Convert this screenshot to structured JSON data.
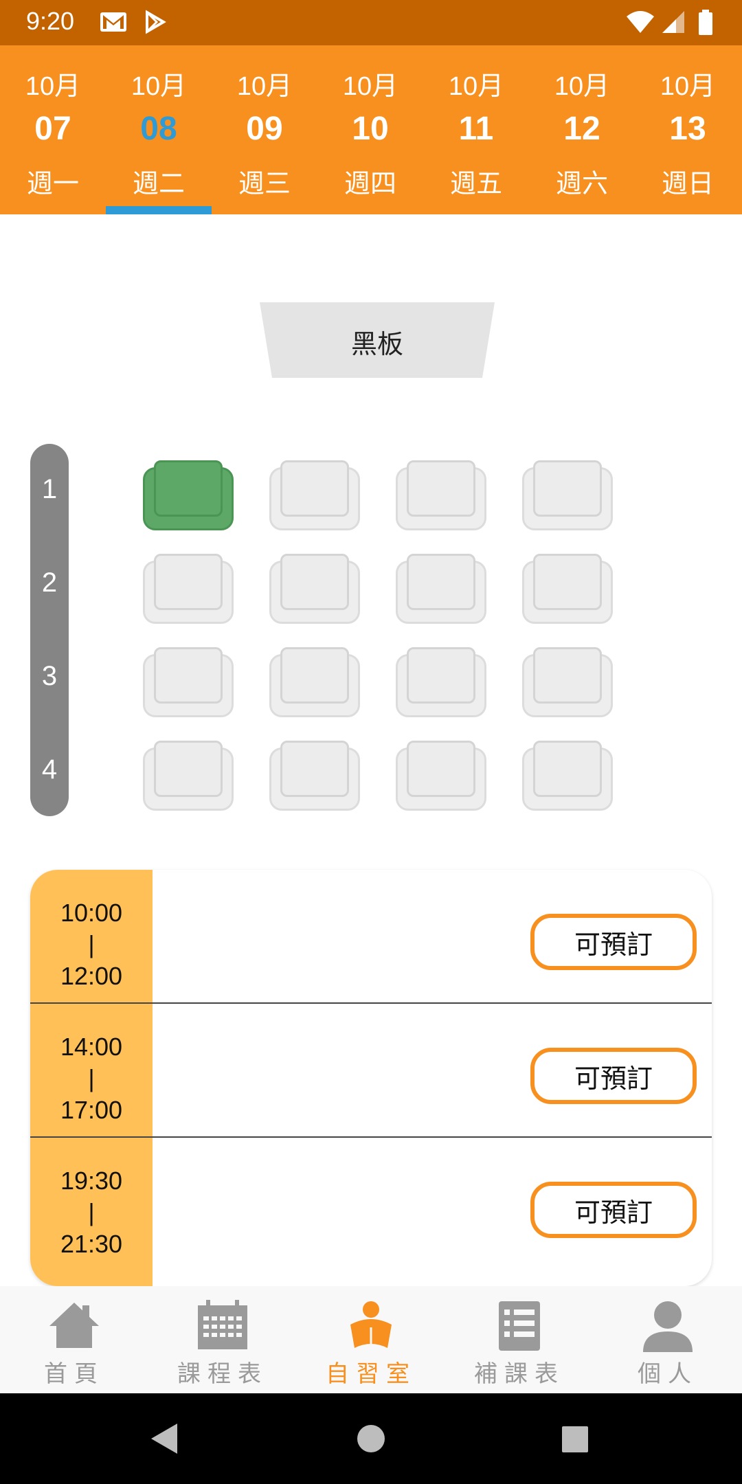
{
  "status_bar": {
    "time": "9:20"
  },
  "dates": [
    {
      "month": "10月",
      "day": "07",
      "weekday": "週一",
      "active": false
    },
    {
      "month": "10月",
      "day": "08",
      "weekday": "週二",
      "active": true
    },
    {
      "month": "10月",
      "day": "09",
      "weekday": "週三",
      "active": false
    },
    {
      "month": "10月",
      "day": "10",
      "weekday": "週四",
      "active": false
    },
    {
      "month": "10月",
      "day": "11",
      "weekday": "週五",
      "active": false
    },
    {
      "month": "10月",
      "day": "12",
      "weekday": "週六",
      "active": false
    },
    {
      "month": "10月",
      "day": "13",
      "weekday": "週日",
      "active": false
    }
  ],
  "blackboard": {
    "label": "黑板"
  },
  "rows": [
    "1",
    "2",
    "3",
    "4"
  ],
  "seats": [
    [
      "selected",
      "available",
      "available",
      "available"
    ],
    [
      "available",
      "available",
      "available",
      "available"
    ],
    [
      "available",
      "available",
      "available",
      "available"
    ],
    [
      "available",
      "available",
      "available",
      "available"
    ]
  ],
  "slots": [
    {
      "start": "10:00",
      "sep": "|",
      "end": "12:00",
      "button": "可預訂"
    },
    {
      "start": "14:00",
      "sep": "|",
      "end": "17:00",
      "button": "可預訂"
    },
    {
      "start": "19:30",
      "sep": "|",
      "end": "21:30",
      "button": "可預訂"
    }
  ],
  "nav": [
    {
      "label": "首頁",
      "icon": "home-icon",
      "active": false
    },
    {
      "label": "課程表",
      "icon": "calendar-icon",
      "active": false
    },
    {
      "label": "自習室",
      "icon": "study-room-icon",
      "active": true
    },
    {
      "label": "補課表",
      "icon": "list-icon",
      "active": false
    },
    {
      "label": "個人",
      "icon": "person-icon",
      "active": false
    }
  ],
  "colors": {
    "status_bar": "#c26300",
    "header": "#f7901e",
    "active_date": "#2e9bd6",
    "selected_seat": "#5da866",
    "time_cell": "#ffc057",
    "nav_active": "#f7901e",
    "nav_inactive": "#9a9a9a"
  }
}
